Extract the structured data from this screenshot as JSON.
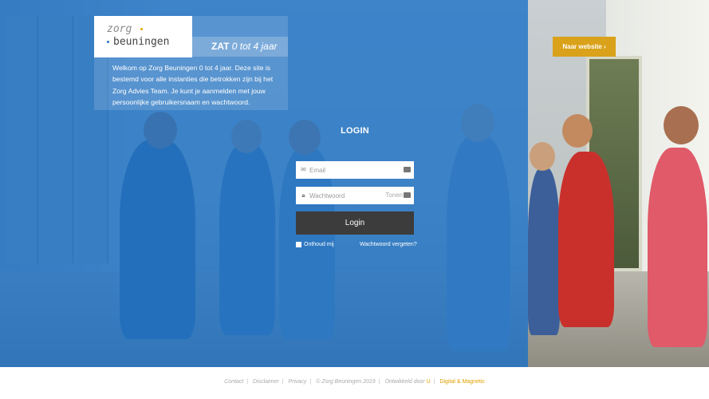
{
  "brand": {
    "logo_line1": "zorg",
    "logo_line2": "beuningen",
    "tag_bold": "ZAT",
    "tag_italic": "0 tot 4 jaar",
    "intro": "Welkom op Zorg Beuningen 0 tot 4 jaar. Deze site is bestemd voor alle instanties die betrokken zijn bij het Zorg Advies Team. Je kunt je aanmelden met jouw persoonlijke gebruikersnaam en wachtwoord."
  },
  "login": {
    "title": "LOGIN",
    "email_placeholder": "Email",
    "password_placeholder": "Wachtwoord",
    "show_password": "Tonen",
    "submit_label": "Login",
    "remember_label": "Onthoud mij",
    "forgot_label": "Wachtwoord vergeten?"
  },
  "header_button": {
    "label": "Naar website ›"
  },
  "footer": {
    "contact": "Contact",
    "disclaimer": "Disclaimer",
    "privacy": "Privacy",
    "copyright": "© Zorg Beuningen 2019",
    "developed_by": "Ontwikkeld door",
    "dev1": "U",
    "dev2": "Digital & Magnetic"
  },
  "colors": {
    "overlay": "#1a70c7",
    "accent": "#d9a21a",
    "button_dark": "#3c3c3c"
  },
  "icons": {
    "email": "envelope-icon",
    "password": "lock-icon",
    "keyboard": "keyboard-icon"
  }
}
